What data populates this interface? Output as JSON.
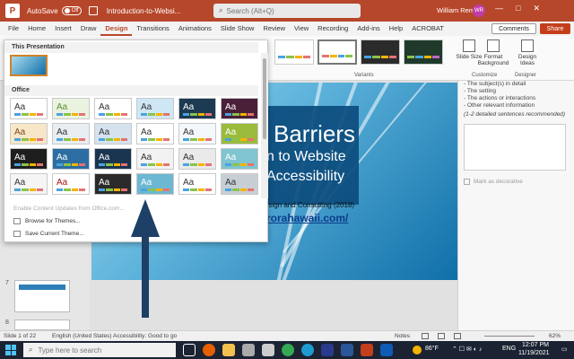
{
  "window": {
    "autosave_label": "AutoSave",
    "autosave_state": "Off",
    "doc_title": "Introduction-to-Websi...",
    "search_placeholder": "Search (Alt+Q)",
    "user_name": "William Rems",
    "user_initials": "WR",
    "controls": [
      "—",
      "□",
      "✕"
    ]
  },
  "tabs": [
    "File",
    "Home",
    "Insert",
    "Draw",
    "Design",
    "Transitions",
    "Animations",
    "Slide Show",
    "Review",
    "View",
    "Recording",
    "Add-ins",
    "Help",
    "ACROBAT"
  ],
  "active_tab": "Design",
  "buttons": {
    "comments": "Comments",
    "share": "Share"
  },
  "ribbon": {
    "variants_label": "Variants",
    "slide_size": "Slide Size",
    "format_background": "Format Background",
    "design_ideas": "Design Ideas",
    "customize_label": "Customize",
    "designer_label": "Designer"
  },
  "themes_menu": {
    "this_presentation": "This Presentation",
    "office": "Office",
    "theme_glyph": "Aa",
    "enable_updates": "Enable Content Updates from Office.com...",
    "browse_themes": "Browse for Themes...",
    "save_theme": "Save Current Theme..."
  },
  "slide": {
    "title_line1": "Barriers",
    "title_line2": "n to Website",
    "title_line3": "Accessibility",
    "subtitle": "esign and Consulting (2018)",
    "url": "rorahawaii.com/"
  },
  "thumbnail_numbers": [
    "7",
    "8"
  ],
  "alt_pane": {
    "lines": [
      "- The subject(s) in detail",
      "- The setting",
      "- The actions or interactions",
      "- Other relevant information"
    ],
    "hint": "(1-2 detailed sentences recommended)",
    "decorative_label": "Mark as decorative"
  },
  "status": {
    "slide_info": "Slide 1 of 22",
    "language": "English (United States)",
    "accessibility": "Accessibility: Good to go",
    "notes": "Notes",
    "zoom": "62%"
  },
  "taskbar": {
    "search_placeholder": "Type here to search",
    "weather": "86°F",
    "lang": "ENG",
    "time": "12:07 PM",
    "date": "11/19/2021"
  },
  "colors": {
    "accent": "#b7472a",
    "share": "#c43e1c",
    "title_box": "#0b4c7d"
  }
}
